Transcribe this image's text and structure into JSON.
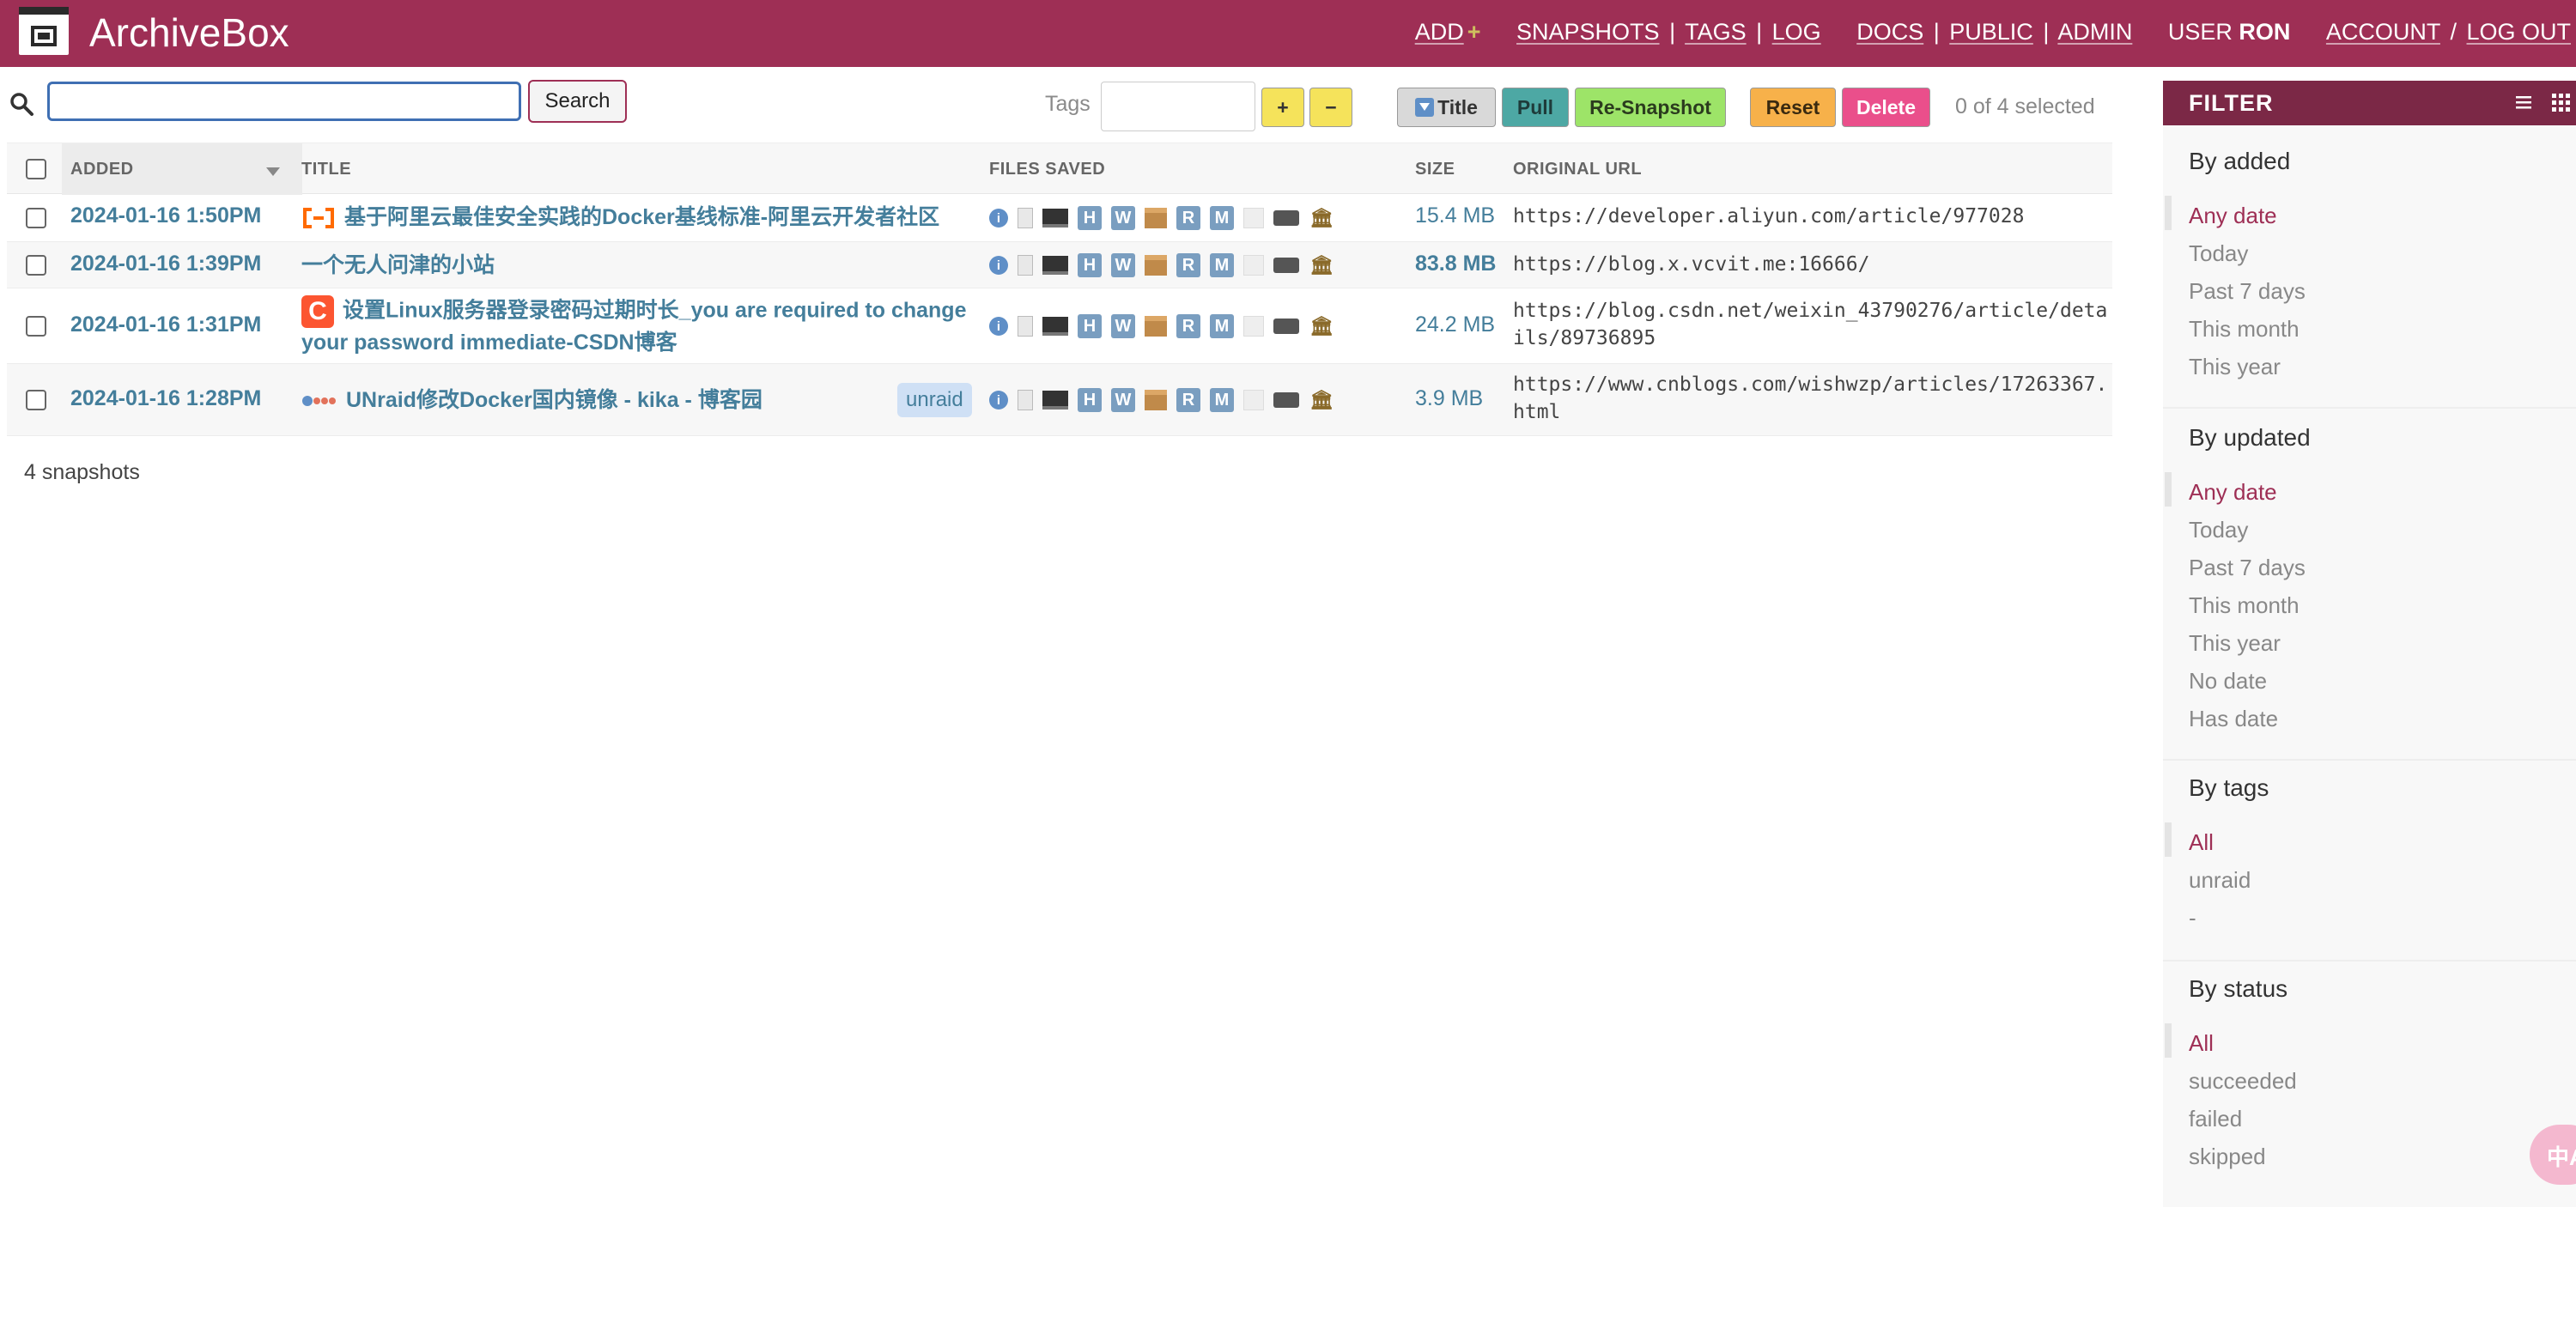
{
  "header": {
    "brand": "ArchiveBox",
    "nav": {
      "add": "ADD",
      "add_plus": "+",
      "snapshots": "SNAPSHOTS",
      "tags": "TAGS",
      "log": "LOG",
      "docs": "DOCS",
      "public": "PUBLIC",
      "admin": "ADMIN",
      "user_label": "USER",
      "user_name": "RON",
      "account": "ACCOUNT",
      "logout": "LOG OUT",
      "sep_bar": "|",
      "sep_slash": "/"
    }
  },
  "toolbar": {
    "search_value": "",
    "search_button": "Search",
    "tags_label": "Tags",
    "tags_value": "",
    "add_tag": "+",
    "remove_tag": "−",
    "title_button": "Title",
    "pull_button": "Pull",
    "resnapshot_button": "Re-Snapshot",
    "reset_button": "Reset",
    "delete_button": "Delete",
    "selection": "0 of 4 selected"
  },
  "table": {
    "headers": {
      "added": "ADDED",
      "title": "TITLE",
      "files": "FILES SAVED",
      "size": "SIZE",
      "url": "ORIGINAL URL"
    },
    "file_letters": {
      "h": "H",
      "w": "W",
      "r": "R",
      "m": "M",
      "info": "i"
    },
    "rows": [
      {
        "added": "2024-01-16 1:50PM",
        "title": "基于阿里云最佳安全实践的Docker基线标准-阿里云开发者社区",
        "size": "15.4 MB",
        "url": "https://developer.aliyun.com/article/977028",
        "favicon": "aliyun-icon"
      },
      {
        "added": "2024-01-16 1:39PM",
        "title": "一个无人问津的小站",
        "size": "83.8 MB",
        "url": "https://blog.x.vcvit.me:16666/",
        "favicon": ""
      },
      {
        "added": "2024-01-16 1:31PM",
        "title": "设置Linux服务器登录密码过期时长_you are required to change your password immediate-CSDN博客",
        "size": "24.2 MB",
        "url": "https://blog.csdn.net/weixin_43790276/article/details/89736895",
        "favicon": "csdn-icon",
        "favicon_letter": "C"
      },
      {
        "added": "2024-01-16 1:28PM",
        "title": "UNraid修改Docker国内镜像 - kika - 博客园",
        "size": "3.9 MB",
        "url": "https://www.cnblogs.com/wishwzp/articles/17263367.html",
        "favicon": "cnblogs-icon",
        "tag": "unraid"
      }
    ],
    "count": "4 snapshots"
  },
  "filter": {
    "title": "FILTER",
    "groups": [
      {
        "title": "By added",
        "items": [
          "Any date",
          "Today",
          "Past 7 days",
          "This month",
          "This year"
        ]
      },
      {
        "title": "By updated",
        "items": [
          "Any date",
          "Today",
          "Past 7 days",
          "This month",
          "This year",
          "No date",
          "Has date"
        ]
      },
      {
        "title": "By tags",
        "items": [
          "All",
          "unraid",
          "-"
        ]
      },
      {
        "title": "By status",
        "items": [
          "All",
          "succeeded",
          "failed",
          "skipped"
        ]
      }
    ]
  },
  "fab": {
    "label": "中A"
  },
  "colors": {
    "brand": "#9e2f55",
    "filter_header": "#7b2846",
    "link": "#447e9b",
    "pull": "#4da8a4",
    "resnapshot": "#9de468",
    "reset": "#f7b14a",
    "delete": "#ea4f8b",
    "tag_button": "#f5e35b"
  }
}
